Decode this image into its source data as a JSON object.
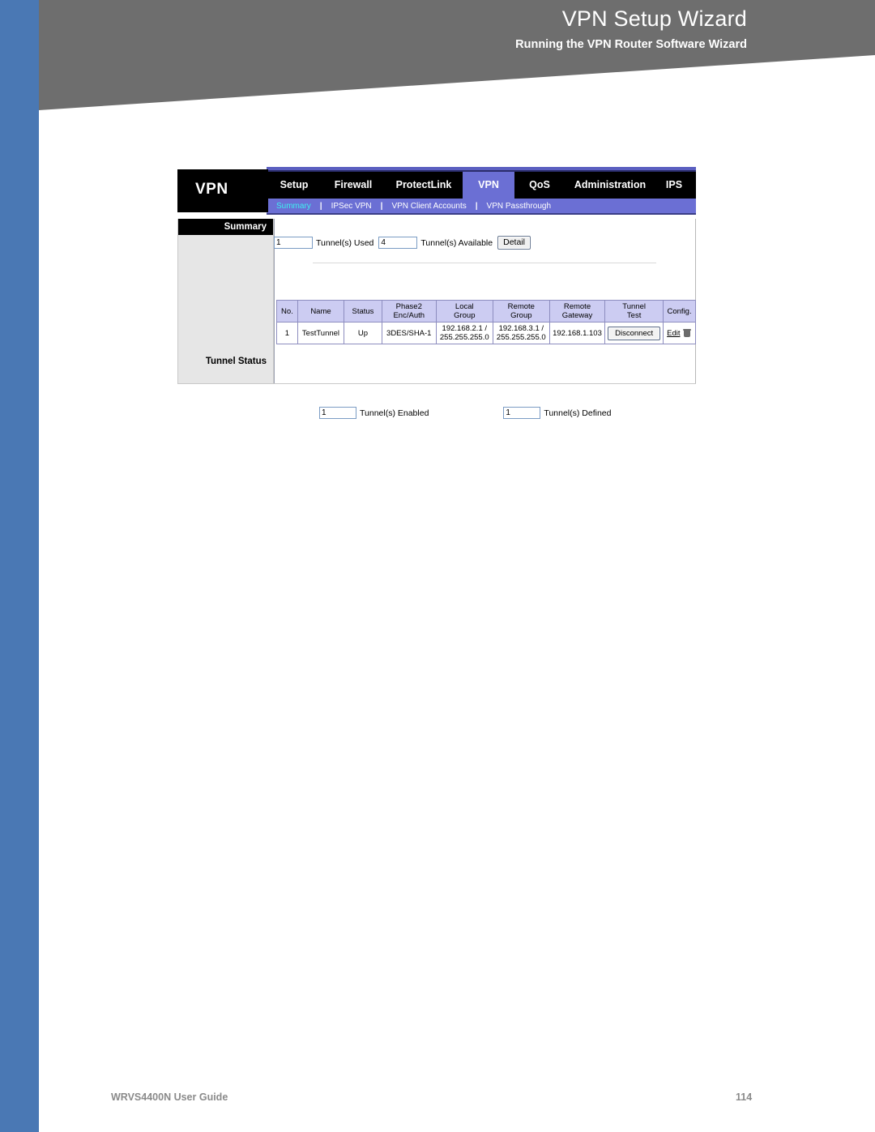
{
  "page": {
    "banner_title": "VPN Setup Wizard",
    "banner_subtitle": "Running the VPN Router Software Wizard",
    "accent_blue": "#4a78b4",
    "banner_gray": "#6e6e6e",
    "nav_purple": "#6b6fd4",
    "table_header_lavender": "#ccccf2"
  },
  "footer": {
    "guide_label": "WRVS4400N User Guide",
    "page_number": "114"
  },
  "router_ui": {
    "brand": "VPN",
    "nav_tabs": [
      {
        "label": "Setup",
        "active": false
      },
      {
        "label": "Firewall",
        "active": false
      },
      {
        "label": "ProtectLink",
        "active": false
      },
      {
        "label": "VPN",
        "active": true
      },
      {
        "label": "QoS",
        "active": false
      },
      {
        "label": "Administration",
        "active": false
      },
      {
        "label": "IPS",
        "active": false
      }
    ],
    "subnav": [
      {
        "label": "Summary",
        "active": true
      },
      {
        "label": "IPSec VPN",
        "active": false
      },
      {
        "label": "VPN Client Accounts",
        "active": false
      },
      {
        "label": "VPN Passthrough",
        "active": false
      }
    ],
    "subnav_separator": "|",
    "sidebar": {
      "header": "Summary",
      "section_label": "Tunnel Status"
    },
    "summary": {
      "tunnels_used_value": "1",
      "tunnels_used_label": "Tunnel(s) Used",
      "tunnels_available_value": "4",
      "tunnels_available_label": "Tunnel(s) Available",
      "detail_button": "Detail"
    },
    "tunnel_table": {
      "columns": [
        "No.",
        "Name",
        "Status",
        "Phase2\nEnc/Auth",
        "Local\nGroup",
        "Remote\nGroup",
        "Remote\nGateway",
        "Tunnel\nTest",
        "Config."
      ],
      "columns_display": [
        {
          "line1": "No.",
          "line2": ""
        },
        {
          "line1": "Name",
          "line2": ""
        },
        {
          "line1": "Status",
          "line2": ""
        },
        {
          "line1": "Phase2",
          "line2": "Enc/Auth"
        },
        {
          "line1": "Local",
          "line2": "Group"
        },
        {
          "line1": "Remote",
          "line2": "Group"
        },
        {
          "line1": "Remote",
          "line2": "Gateway"
        },
        {
          "line1": "Tunnel",
          "line2": "Test"
        },
        {
          "line1": "Config.",
          "line2": ""
        }
      ],
      "rows": [
        {
          "no": "1",
          "name": "TestTunnel",
          "status": "Up",
          "phase2_enc_auth": "3DES/SHA-1",
          "local_group_line1": "192.168.2.1 /",
          "local_group_line2": "255.255.255.0",
          "remote_group_line1": "192.168.3.1 /",
          "remote_group_line2": "255.255.255.0",
          "remote_gateway": "192.168.1.103",
          "tunnel_test_button": "Disconnect",
          "config_edit": "Edit",
          "config_delete_icon": "trash-icon"
        }
      ]
    },
    "footer_counters": {
      "tunnels_enabled_value": "1",
      "tunnels_enabled_label": "Tunnel(s) Enabled",
      "tunnels_defined_value": "1",
      "tunnels_defined_label": "Tunnel(s) Defined"
    }
  }
}
